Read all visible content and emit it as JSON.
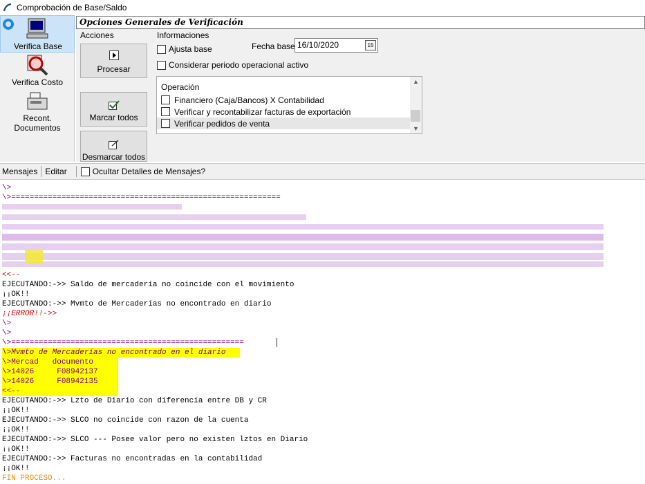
{
  "window": {
    "title": "Comprobación de Base/Saldo"
  },
  "sidebar": {
    "items": [
      {
        "label": "Verifica Base",
        "icon": "computer-icon",
        "active": true
      },
      {
        "label": "Verifica Costo",
        "icon": "magnifier-icon",
        "active": false
      },
      {
        "label": "Recont. Documentos",
        "icon": "cash-register-icon",
        "active": false
      }
    ]
  },
  "main": {
    "header": "Opciones Generales de Verificación",
    "acciones": {
      "label": "Acciones",
      "procesar": "Procesar",
      "marcar_todos": "Marcar todos",
      "desmarcar_todos": "Desmarcar todos"
    },
    "informaciones": {
      "label": "Informaciones",
      "ajusta_base": "Ajusta base",
      "fecha_base_label": "Fecha base",
      "fecha_base_value": "16/10/2020",
      "considerar": "Considerar periodo operacional activo"
    },
    "operacion": {
      "header": "Operación",
      "items": [
        "Financiero (Caja/Bancos) X Contabilidad",
        "Verificar y recontabilizar facturas de exportación",
        "Verificar pedidos de venta"
      ]
    }
  },
  "messages_bar": {
    "mensajes": "Mensajes",
    "editar": "Editar",
    "ocultar": "Ocultar Detalles de Mensajes?"
  },
  "log": {
    "prompt": "\\>",
    "sep1": "\\>===========================================================",
    "blurred_end": "<<--",
    "l1": "EJECUTANDO:->> Saldo de mercadería no coincide con el movimiento",
    "l2": "¡¡OK!!",
    "l3": "EJECUTANDO:->> Mvmto de Mercaderías no encontrado en diario",
    "l4": "¡¡ERROR!!->>",
    "l5": "\\>",
    "l6": "\\>",
    "sep2": "\\>===================================================",
    "hl1": "\\>Mvmto de Mercaderías no encontrado en el diario",
    "hl2": "\\>Mercad   documento",
    "hl3": "\\>14026     F08942137",
    "hl4": "\\>14026     F08942135",
    "hl5": "<<--",
    "l7": "EJECUTANDO:->> Lzto de Diario con diferencia entre DB y CR",
    "l8": "¡¡OK!!",
    "l9": "EJECUTANDO:->> SLCO no coincide con razon de la cuenta",
    "l10": "¡¡OK!!",
    "l11": "EJECUTANDO:->> SLCO --- Posee valor pero no existen lztos en Diario",
    "l12": "¡¡OK!!",
    "l13": "EJECUTANDO:->> Facturas no encontradas en la contabilidad",
    "l14": "¡¡OK!!",
    "l15": "FIN PROCESO..."
  }
}
